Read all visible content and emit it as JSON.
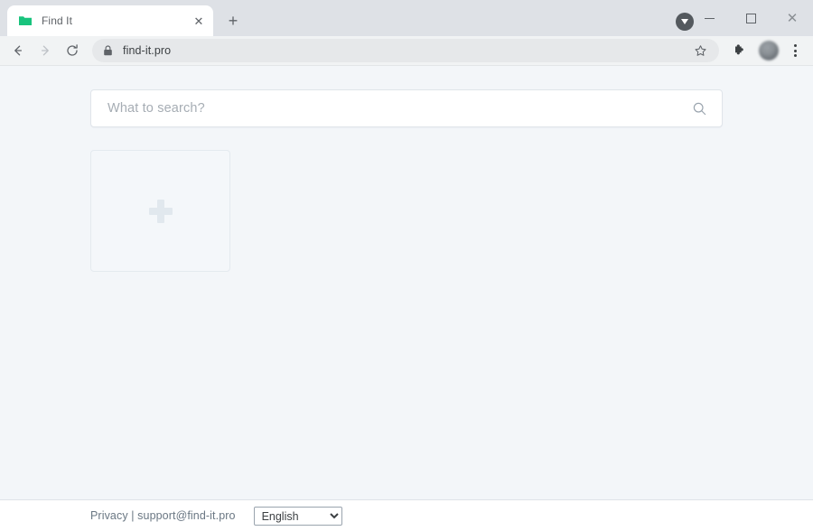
{
  "browser": {
    "tab": {
      "title": "Find It",
      "favicon": "folder-icon",
      "favicon_color": "#19c37d",
      "close_label": "✕"
    },
    "new_tab_label": "+",
    "window_controls": {
      "minimize_label": "—",
      "maximize_label": "□",
      "close_label": "✕"
    },
    "download_indicator": "download-icon",
    "toolbar": {
      "back_label": "←",
      "forward_label": "→",
      "reload_label": "↻",
      "security_icon": "lock-icon",
      "url": "find-it.pro",
      "bookmark_icon": "star-icon",
      "extensions_icon": "puzzle-icon",
      "profile_icon": "avatar",
      "menu_icon": "three-dot-menu-icon"
    }
  },
  "page": {
    "search": {
      "placeholder": "What to search?",
      "value": "",
      "icon": "search-icon"
    },
    "shortcuts": {
      "add_tile_icon": "plus-icon"
    },
    "footer": {
      "links_text": "Privacy | support@find-it.pro",
      "privacy_label": "Privacy",
      "support_label": "support@find-it.pro",
      "language": {
        "selected": "English",
        "options": [
          "English"
        ]
      }
    },
    "colors": {
      "background": "#f3f6f9",
      "tile_border": "#e4eaef",
      "accent_green": "#19c37d",
      "footer_text": "#6a7783"
    }
  }
}
